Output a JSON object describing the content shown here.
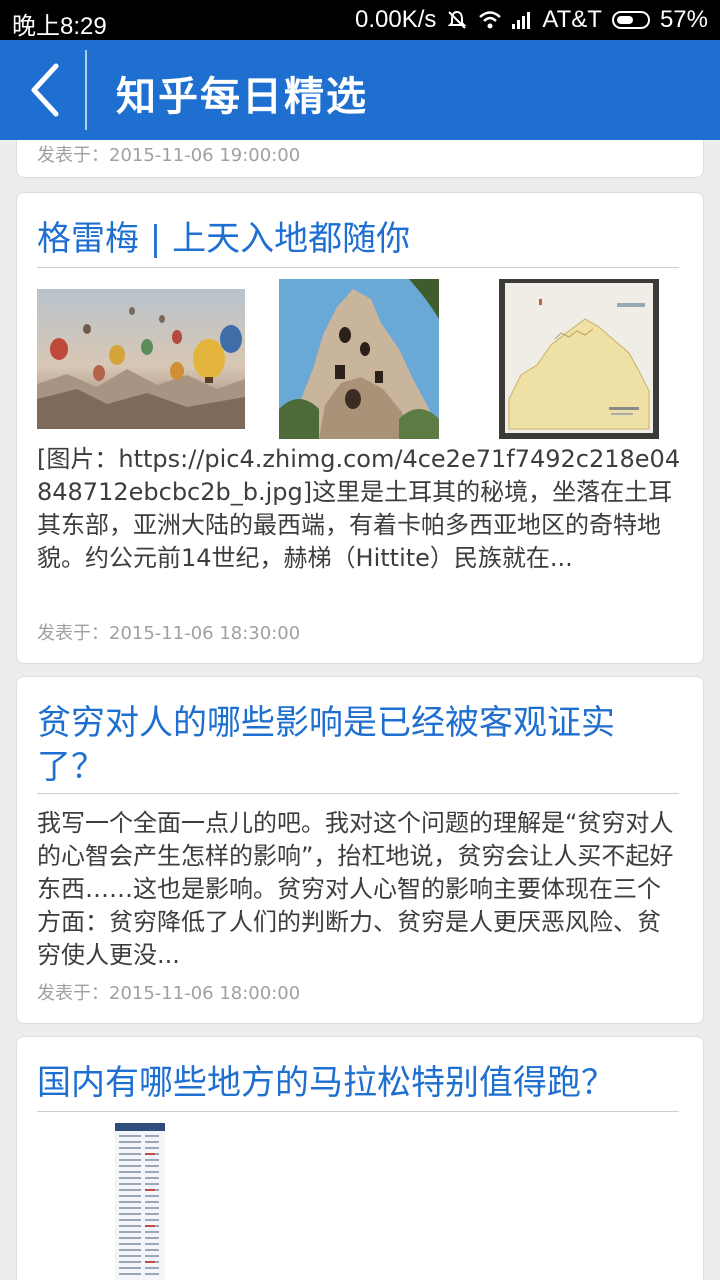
{
  "status": {
    "time": "晚上8:29",
    "net_speed": "0.00K/s",
    "carrier": "AT&T",
    "battery": "57%"
  },
  "appbar": {
    "title": "知乎每日精选",
    "back_icon": "back-chevron-icon"
  },
  "cards": [
    {
      "date": "发表于：2015-11-06 19:00:00"
    },
    {
      "title": "格雷梅 | 上天入地都随你",
      "images": [
        "hot-air-balloons-photo",
        "rock-chimney-photo",
        "hand-drawn-map-photo"
      ],
      "excerpt": "[图片：https://pic4.zhimg.com/4ce2e71f7492c218e04848712ebcbc2b_b.jpg]这里是土耳其的秘境，坐落在土耳其东部，亚洲大陆的最西端，有着卡帕多西亚地区的奇特地貌。约公元前14世纪，赫梯（Hittite）民族就在...",
      "date": "发表于：2015-11-06 18:30:00"
    },
    {
      "title": "贫穷对人的哪些影响是已经被客观证实了？",
      "excerpt": "我写一个全面一点儿的吧。我对这个问题的理解是“贫穷对人的心智会产生怎样的影响”，抬杠地说，贫穷会让人买不起好东西……这也是影响。贫穷对人心智的影响主要体现在三个方面：贫穷降低了人们的判断力、贫穷是人更厌恶风险、贫穷使人更没...",
      "date": "发表于：2015-11-06 18:00:00"
    },
    {
      "title": "国内有哪些地方的马拉松特别值得跑？",
      "images": [
        "marathon-table-screenshot"
      ]
    }
  ]
}
